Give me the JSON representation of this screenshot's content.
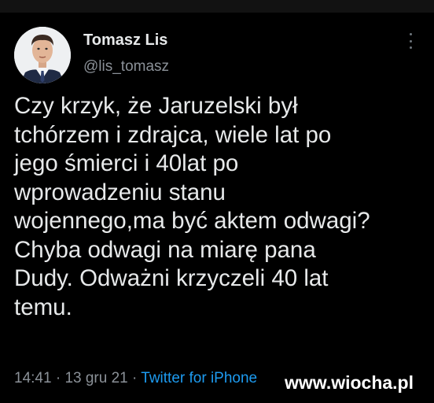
{
  "tweet": {
    "author": {
      "name": "Tomasz Lis",
      "handle": "@lis_tomasz"
    },
    "text_lines": [
      "Czy krzyk, że Jaruzelski był",
      "tchórzem i zdrajca, wiele lat po",
      "jego śmierci i 40lat po",
      "wprowadzeniu stanu",
      "wojennego,ma być aktem odwagi?",
      "Chyba odwagi na miarę pana",
      "Dudy. Odważni krzyczeli 40 lat",
      "temu."
    ],
    "time": "14:41",
    "date": "13 gru 21",
    "separator": "·",
    "source": "Twitter for iPhone"
  },
  "watermark": "www.wiocha.pl",
  "colors": {
    "background": "#000000",
    "text": "#e7e9ea",
    "muted": "#8b9198",
    "link": "#1d9bf0"
  },
  "icons": {
    "more": "more-vertical-icon"
  }
}
